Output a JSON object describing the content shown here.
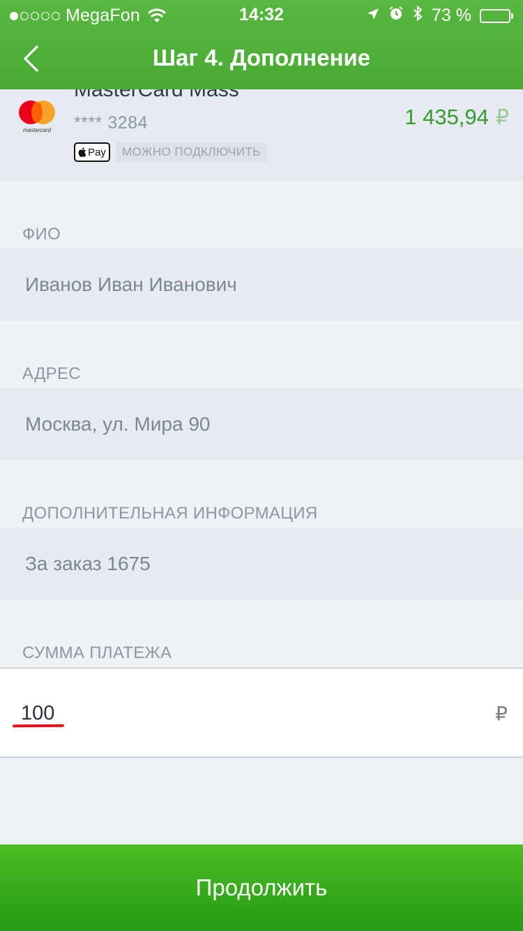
{
  "status_bar": {
    "carrier": "MegaFon",
    "signal_bars_filled": 1,
    "signal_bars_total": 5,
    "time": "14:32",
    "battery_percent": "73 %",
    "battery_level": 0.73
  },
  "header": {
    "title": "Шаг 4. Дополнение",
    "color": "#4fb23b"
  },
  "card": {
    "name": "MasterCard Mass",
    "number": "**** 3284",
    "balance": "1 435,94",
    "currency": "₽",
    "apple_pay_label": "Pay",
    "connect_label": "МОЖНО ПОДКЛЮЧИТЬ",
    "brand_text": "mastercard"
  },
  "form": {
    "fio_label": "ФИО",
    "fio_value": "Иванов Иван Иванович",
    "address_label": "АДРЕС",
    "address_value": "Москва, ул. Мира 90",
    "extra_label": "ДОПОЛНИТЕЛЬНАЯ ИНФОРМАЦИЯ",
    "extra_value": "За заказ 1675",
    "amount_label": "СУММА ПЛАТЕЖА",
    "amount_value": "100",
    "amount_currency": "₽"
  },
  "footer": {
    "continue_label": "Продолжить",
    "color": "#3aab1d"
  }
}
